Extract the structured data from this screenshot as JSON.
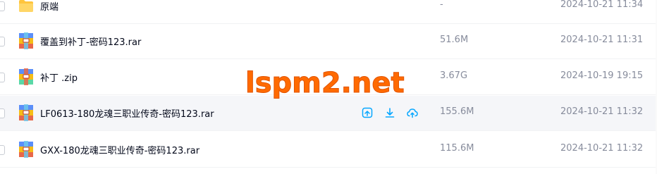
{
  "files": [
    {
      "name": "原端",
      "size": "-",
      "date": "2024-10-21 11:34",
      "type": "folder"
    },
    {
      "name": "覆盖到补丁-密码123.rar",
      "size": "51.6M",
      "date": "2024-10-21 11:31",
      "type": "archive"
    },
    {
      "name": "补丁 .zip",
      "size": "3.67G",
      "date": "2024-10-19 19:15",
      "type": "archive"
    },
    {
      "name": "LF0613-180龙魂三职业传奇-密码123.rar",
      "size": "155.6M",
      "date": "2024-10-21 11:32",
      "type": "archive"
    },
    {
      "name": "GXX-180龙魂三职业传奇-密码123.rar",
      "size": "115.6M",
      "date": "2024-10-21 11:32",
      "type": "archive"
    }
  ],
  "watermark": "lspm2.net",
  "icons": {
    "folder": "folder-icon",
    "archive": "archive-icon",
    "actions": [
      "share-icon",
      "download-icon",
      "cloud-upload-icon"
    ]
  },
  "colors": {
    "accent": "#06a7ff",
    "watermark": "#ff6a00",
    "hover_row": "#f5f6f9",
    "folder": "#ffc53d"
  }
}
